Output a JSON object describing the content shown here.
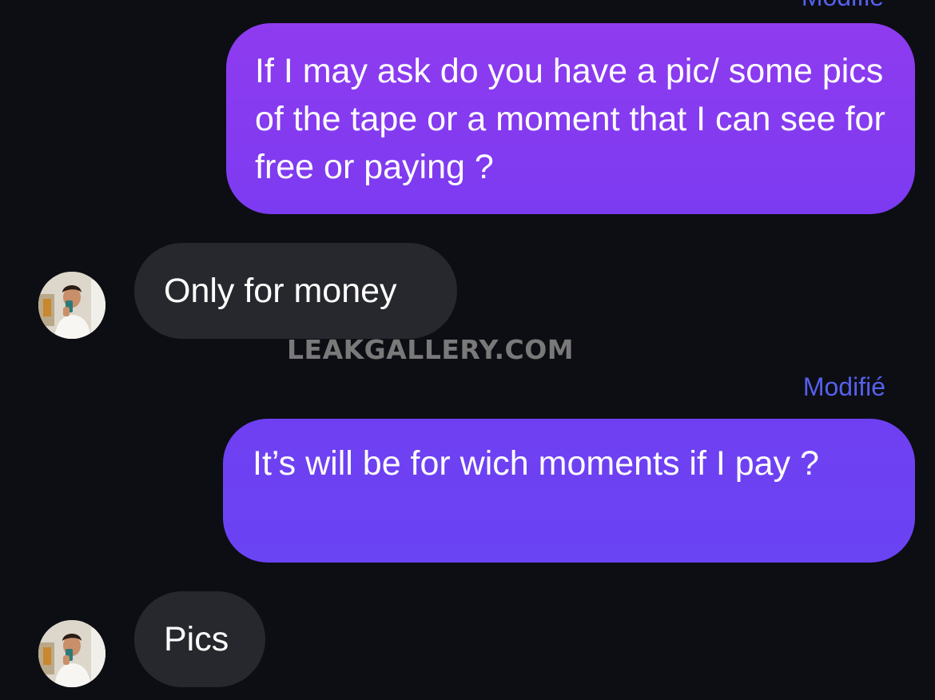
{
  "messages": [
    {
      "side": "sent",
      "edited_label": "Modifié",
      "text": "If I may ask do you have a pic/ some pics of the tape or a moment that I can see for free or paying ?"
    },
    {
      "side": "received",
      "text": "Only for money"
    },
    {
      "side": "sent",
      "edited_label": "Modifié",
      "text": "It’s will be for wich moments  if I pay ?"
    },
    {
      "side": "received",
      "text": "Pics"
    }
  ],
  "watermark": "LEAKGALLERY.COM",
  "icons": {
    "avatar": "contact-avatar-photo"
  },
  "colors": {
    "background": "#0c0e13",
    "sent_bubble_top": "#8f3bef",
    "sent_bubble_bottom": "#6a43f3",
    "received_bubble": "#26282d",
    "edited_label": "#5660ee",
    "text": "#ffffff"
  }
}
